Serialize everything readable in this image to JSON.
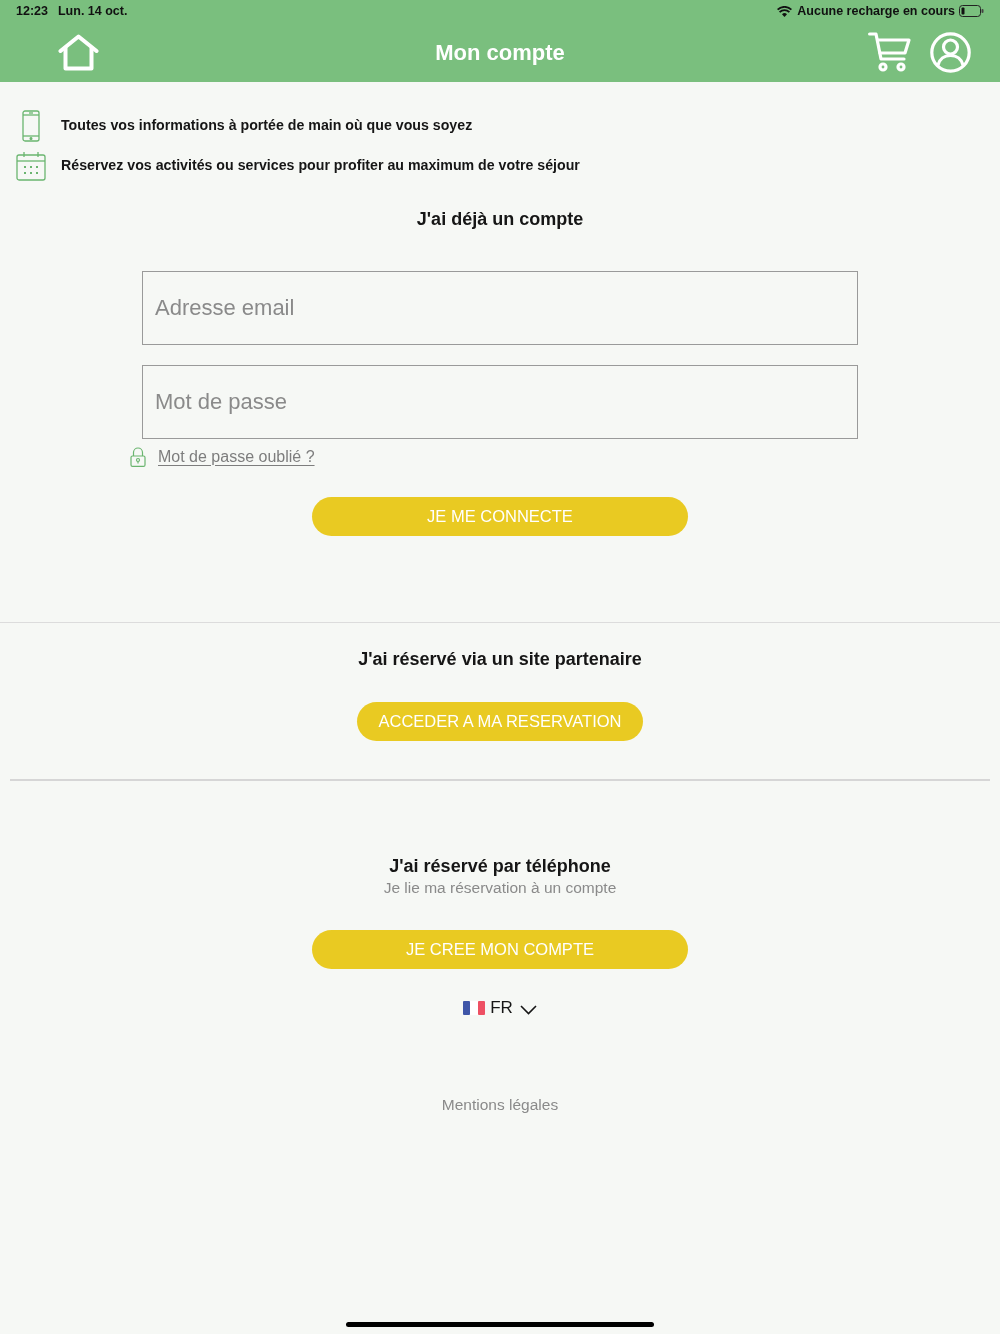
{
  "status_bar": {
    "time": "12:23",
    "date": "Lun. 14 oct.",
    "battery_text": "Aucune recharge en cours"
  },
  "nav_bar": {
    "title": "Mon compte"
  },
  "features": [
    {
      "kind": "phone",
      "text": "Toutes vos informations à portée de main où que vous soyez"
    },
    {
      "kind": "calendar",
      "text": "Réservez vos activités ou services pour profiter au maximum de votre séjour"
    }
  ],
  "login": {
    "title": "J'ai déjà un compte",
    "fields": [
      {
        "placeholder": "Adresse email"
      },
      {
        "placeholder": "Mot de passe"
      }
    ],
    "forgot_link": "Mot de passe oublié ?",
    "button": "JE ME CONNECTE"
  },
  "partner": {
    "title": "J'ai réservé via un site partenaire",
    "button": "ACCEDER A MA RESERVATION"
  },
  "phone_booking": {
    "title": "J'ai réservé par téléphone",
    "subtitle": "Je lie ma réservation à un compte",
    "button": "JE CREE MON COMPTE"
  },
  "language": {
    "code": "FR"
  },
  "footer": {
    "legal_link": "Mentions légales"
  }
}
